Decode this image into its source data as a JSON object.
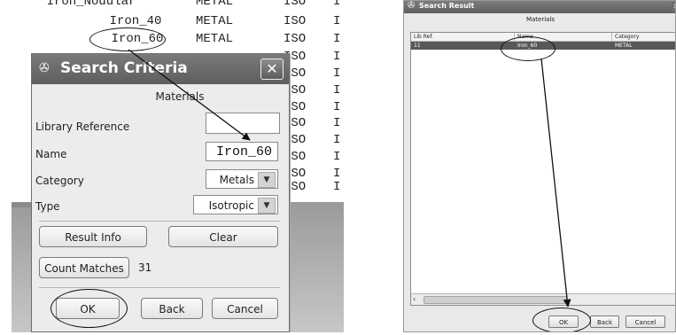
{
  "left": {
    "background_rows": [
      {
        "name": "Iron_Nodular",
        "category": "METAL",
        "type": "ISO",
        "tail": "I"
      },
      {
        "name": "Iron_40",
        "category": "METAL",
        "type": "ISO",
        "tail": "I"
      },
      {
        "name": "Iron_60",
        "category": "METAL",
        "type": "ISO",
        "tail": "I"
      }
    ],
    "background_iso": [
      "ISO",
      "ISO",
      "ISO",
      "ISO",
      "ISO",
      "ISO",
      "ISO",
      "ISO",
      "ISO",
      "ISO"
    ],
    "background_tail": [
      "I",
      "I",
      "I",
      "I",
      "I",
      "I",
      "I",
      "I",
      "I",
      "I"
    ],
    "dialog": {
      "title": "Search Criteria",
      "title_icon": "binoculars-icon",
      "close_glyph": "✕",
      "subtitle": "Materials",
      "library_reference_label": "Library Reference",
      "library_reference_value": "",
      "name_label": "Name",
      "name_value": "Iron_60",
      "category_label": "Category",
      "category_value": "Metals",
      "type_label": "Type",
      "type_value": "Isotropic",
      "result_info_button": "Result Info",
      "clear_button": "Clear",
      "count_matches_button": "Count Matches",
      "count_value": "31",
      "ok_button": "OK",
      "back_button": "Back",
      "cancel_button": "Cancel"
    }
  },
  "right": {
    "title": "Search Result",
    "title_icon": "binoculars-icon",
    "close_glyph": "✕",
    "subtitle": "Materials",
    "columns": [
      "Lib Ref.",
      "Name",
      "Category"
    ],
    "rows": [
      {
        "lib_ref": "11",
        "name": "Iron_60",
        "category": "METAL"
      }
    ],
    "ok_button": "OK",
    "back_button": "Back",
    "cancel_button": "Cancel"
  }
}
